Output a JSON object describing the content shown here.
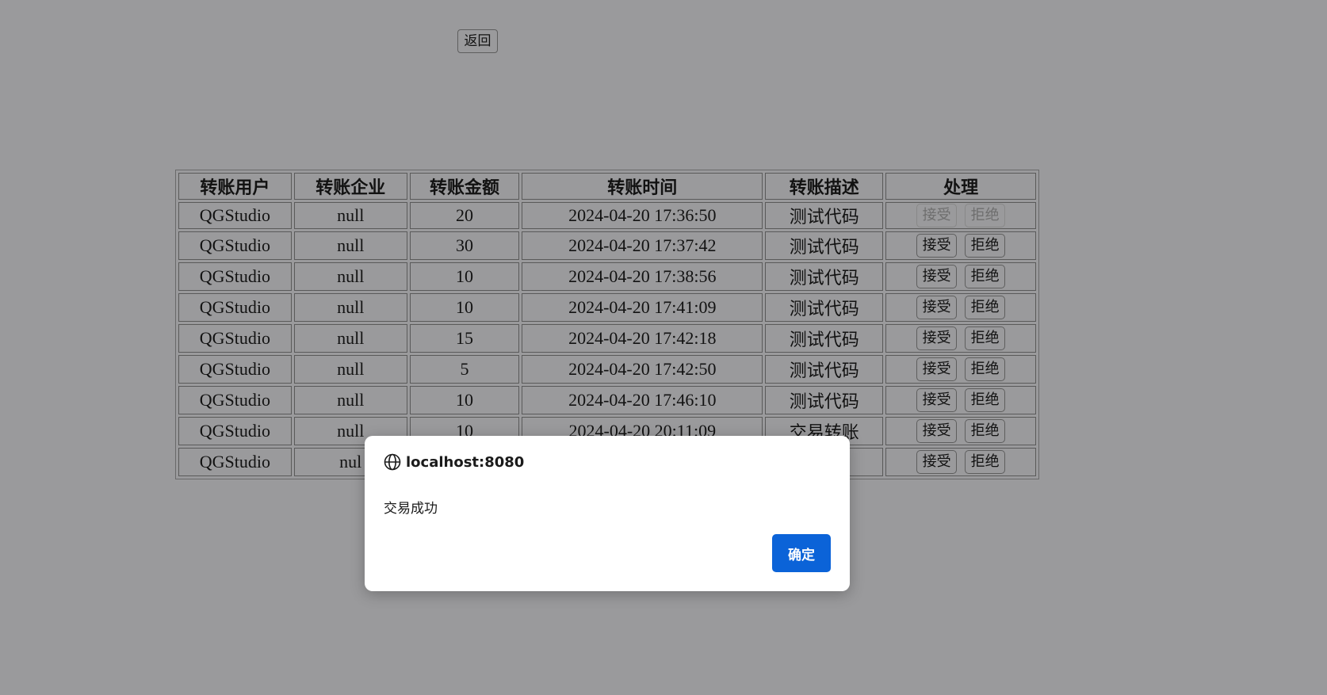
{
  "page": {
    "back_button": "返回"
  },
  "table": {
    "headers": [
      "转账用户",
      "转账企业",
      "转账金额",
      "转账时间",
      "转账描述",
      "处理"
    ],
    "rows": [
      {
        "user": "QGStudio",
        "company": "null",
        "amount": "20",
        "time": "2024-04-20 17:36:50",
        "desc": "测试代码",
        "accept": "接受",
        "reject": "拒绝"
      },
      {
        "user": "QGStudio",
        "company": "null",
        "amount": "30",
        "time": "2024-04-20 17:37:42",
        "desc": "测试代码",
        "accept": "接受",
        "reject": "拒绝"
      },
      {
        "user": "QGStudio",
        "company": "null",
        "amount": "10",
        "time": "2024-04-20 17:38:56",
        "desc": "测试代码",
        "accept": "接受",
        "reject": "拒绝"
      },
      {
        "user": "QGStudio",
        "company": "null",
        "amount": "10",
        "time": "2024-04-20 17:41:09",
        "desc": "测试代码",
        "accept": "接受",
        "reject": "拒绝"
      },
      {
        "user": "QGStudio",
        "company": "null",
        "amount": "15",
        "time": "2024-04-20 17:42:18",
        "desc": "测试代码",
        "accept": "接受",
        "reject": "拒绝"
      },
      {
        "user": "QGStudio",
        "company": "null",
        "amount": "5",
        "time": "2024-04-20 17:42:50",
        "desc": "测试代码",
        "accept": "接受",
        "reject": "拒绝"
      },
      {
        "user": "QGStudio",
        "company": "null",
        "amount": "10",
        "time": "2024-04-20 17:46:10",
        "desc": "测试代码",
        "accept": "接受",
        "reject": "拒绝"
      },
      {
        "user": "QGStudio",
        "company": "null",
        "amount": "10",
        "time": "2024-04-20 20:11:09",
        "desc": "交易转账",
        "accept": "接受",
        "reject": "拒绝"
      },
      {
        "user": "QGStudio",
        "company": "nul",
        "amount": "",
        "time": "",
        "desc": "",
        "accept": "接受",
        "reject": "拒绝"
      }
    ]
  },
  "dialog": {
    "origin": "localhost:8080",
    "origin_icon": "globe-icon",
    "message": "交易成功",
    "ok_label": "确定",
    "ok_color": "#0b63d8"
  }
}
